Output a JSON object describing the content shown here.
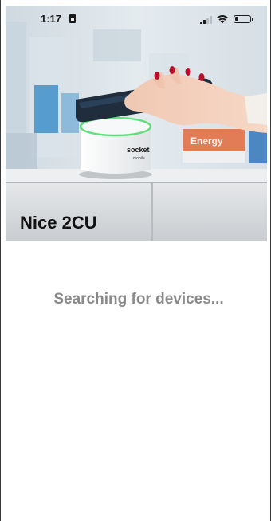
{
  "status_bar": {
    "time": "1:17"
  },
  "hero": {
    "logo_line1": "socket",
    "logo_line2": "mobile",
    "shelf_sign": "Energy"
  },
  "device": {
    "title": "Nice 2CU"
  },
  "main": {
    "status_text": "Searching for devices..."
  }
}
